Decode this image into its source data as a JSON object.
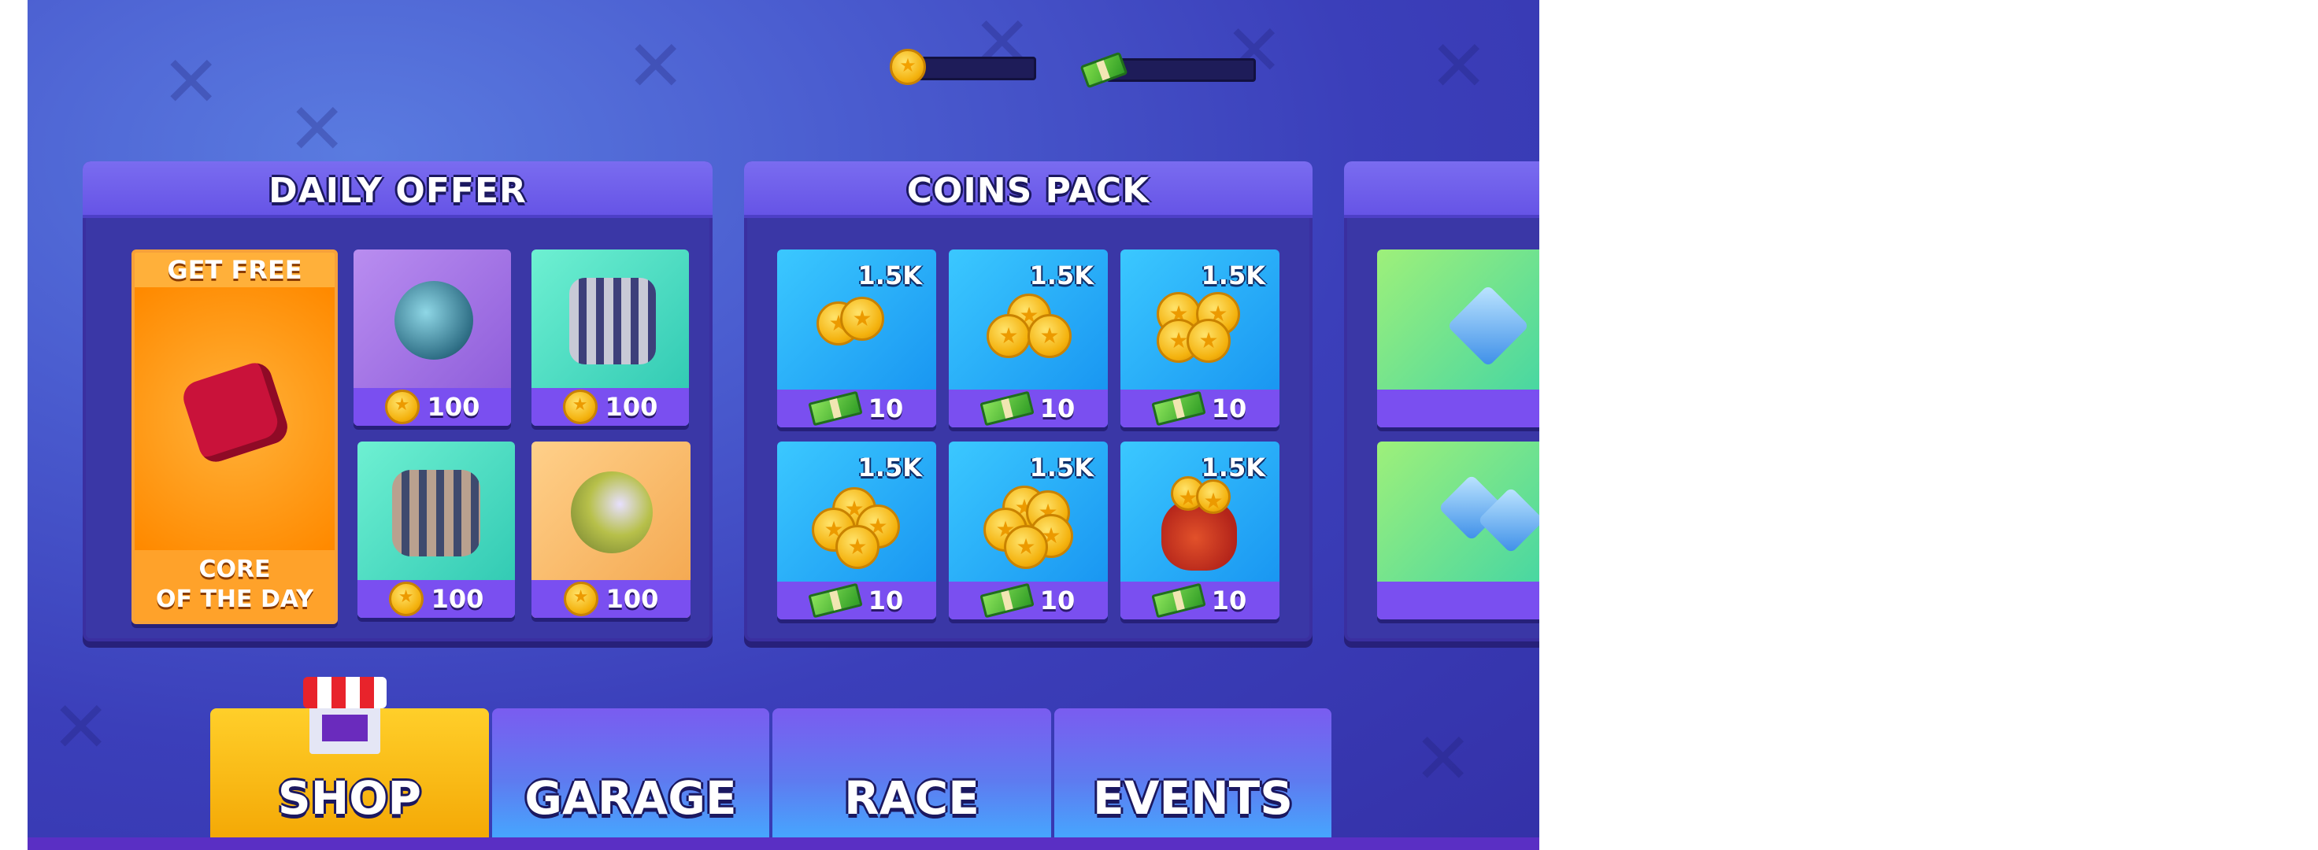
{
  "currencies": {
    "coins": "",
    "cash": ""
  },
  "panels": {
    "daily": {
      "title": "DAILY OFFER",
      "free": {
        "top": "GET FREE",
        "line1": "CORE",
        "line2": "OF THE DAY"
      },
      "items": [
        {
          "price": "100"
        },
        {
          "price": "100"
        },
        {
          "price": "100"
        },
        {
          "price": "100"
        }
      ]
    },
    "coins": {
      "title": "COINS PACK",
      "packs": [
        {
          "amount": "1.5K",
          "price": "10"
        },
        {
          "amount": "1.5K",
          "price": "10"
        },
        {
          "amount": "1.5K",
          "price": "10"
        },
        {
          "amount": "1.5K",
          "price": "10"
        },
        {
          "amount": "1.5K",
          "price": "10"
        },
        {
          "amount": "1.5K",
          "price": "10"
        }
      ]
    }
  },
  "nav": {
    "tabs": [
      {
        "label": "SHOP"
      },
      {
        "label": "GARAGE"
      },
      {
        "label": "RACE"
      },
      {
        "label": "EVENTS"
      }
    ]
  },
  "colors": {
    "accent_yellow": "#f4a805",
    "panel_purple": "#6654e6",
    "coin_gold": "#f4b20e"
  },
  "icons": [
    "coin-icon",
    "cash-icon",
    "shop-icon",
    "gem-icon"
  ]
}
